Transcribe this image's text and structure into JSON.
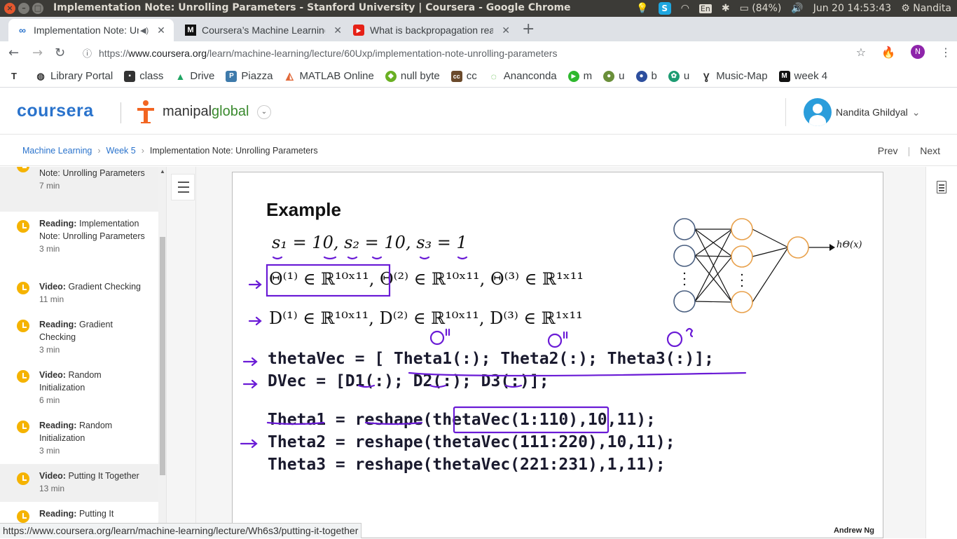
{
  "os": {
    "window_title": "Implementation Note: Unrolling Parameters - Stanford University | Coursera - Google Chrome",
    "battery": "(84%)",
    "datetime": "Jun 20 14:53:43",
    "user": "Nandita",
    "lang": "En"
  },
  "tabs": [
    {
      "label": "Implementation Note: Unrolling Parameters",
      "active": true
    },
    {
      "label": "Coursera’s Machine Learning",
      "active": false
    },
    {
      "label": "What is backpropagation really doing",
      "active": false
    }
  ],
  "address": {
    "scheme": "https://",
    "domain": "www.coursera.org",
    "path": "/learn/machine-learning/lecture/60Uxp/implementation-note-unrolling-parameters",
    "profile_initial": "N"
  },
  "bookmarks": [
    {
      "label": "Library Portal",
      "color": "#555555"
    },
    {
      "label": "class",
      "color": "#333333"
    },
    {
      "label": "Drive",
      "color": "#1fa463"
    },
    {
      "label": "Piazza",
      "color": "#3e7aab"
    },
    {
      "label": "MATLAB Online",
      "color": "#e16737"
    },
    {
      "label": "null byte",
      "color": "#6ab023"
    },
    {
      "label": "cc",
      "color": "#6b4a2b"
    },
    {
      "label": "Ananconda",
      "color": "#43b02a"
    },
    {
      "label": "m",
      "color": "#2eb82e"
    },
    {
      "label": "u",
      "color": "#6a8f3a"
    },
    {
      "label": "b",
      "color": "#2d4f9e"
    },
    {
      "label": "u",
      "color": "#1d9b72"
    },
    {
      "label": "Music-Map",
      "color": "#333333"
    },
    {
      "label": "week 4",
      "color": "#111111"
    }
  ],
  "header": {
    "brand": "coursera",
    "partner_prefix": "manipal",
    "partner_suffix": "global",
    "user_name": "Nandita Ghildyal"
  },
  "breadcrumb": {
    "course": "Machine Learning",
    "week": "Week 5",
    "current": "Implementation Note: Unrolling Parameters",
    "prev": "Prev",
    "next": "Next"
  },
  "sidebar": {
    "items": [
      {
        "kind": "",
        "title": "Note: Unrolling Parameters",
        "duration": "7 min",
        "selected": true
      },
      {
        "kind": "Reading:",
        "title": "Implementation Note: Unrolling Parameters",
        "duration": "3 min",
        "selected": false
      },
      {
        "kind": "Video:",
        "title": "Gradient Checking",
        "duration": "11 min",
        "selected": false
      },
      {
        "kind": "Reading:",
        "title": "Gradient Checking",
        "duration": "3 min",
        "selected": false
      },
      {
        "kind": "Video:",
        "title": "Random Initialization",
        "duration": "6 min",
        "selected": false
      },
      {
        "kind": "Reading:",
        "title": "Random Initialization",
        "duration": "3 min",
        "selected": false
      },
      {
        "kind": "Video:",
        "title": "Putting It Together",
        "duration": "13 min",
        "selected": true
      },
      {
        "kind": "Reading:",
        "title": "Putting It",
        "duration": "",
        "selected": false
      }
    ]
  },
  "slide": {
    "heading": "Example",
    "sizes_line": "s₁ = 10, s₂ = 10, s₃ = 1",
    "theta_line": "Θ⁽¹⁾ ∈ ℝ¹⁰ˣ¹¹, Θ⁽²⁾ ∈ ℝ¹⁰ˣ¹¹, Θ⁽³⁾ ∈ ℝ¹ˣ¹¹",
    "d_line": "D⁽¹⁾ ∈ ℝ¹⁰ˣ¹¹, D⁽²⁾ ∈ ℝ¹⁰ˣ¹¹, D⁽³⁾ ∈ ℝ¹ˣ¹¹",
    "code1": "thetaVec = [ Theta1(:); Theta2(:); Theta3(:)];",
    "code2": "DVec = [D1(:); D2(:); D3(:)];",
    "code3": "Theta1 = reshape(thetaVec(1:110),10,11);",
    "code4": "Theta2 = reshape(thetaVec(111:220),10,11);",
    "code5": "Theta3 = reshape(thetaVec(221:231),1,11);",
    "output_label": "hΘ(x)",
    "author": "Andrew Ng"
  },
  "status_url": "https://www.coursera.org/learn/machine-learning/lecture/Wh6s3/putting-it-together"
}
